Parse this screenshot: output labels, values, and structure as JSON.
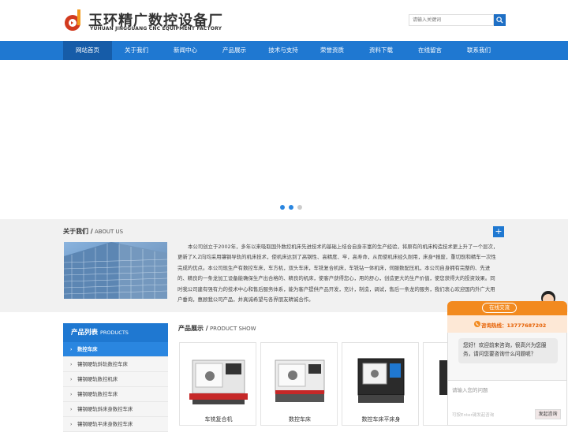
{
  "header": {
    "company_cn": "玉环精广数控设备厂",
    "company_en": "YUHUAN JINGGUANG CNC EQUIPMENT FACTORY",
    "search_placeholder": "请输入关键词"
  },
  "nav": {
    "items": [
      {
        "label": "网站首页",
        "active": true
      },
      {
        "label": "关于我们"
      },
      {
        "label": "新闻中心"
      },
      {
        "label": "产品展示"
      },
      {
        "label": "技术与支持"
      },
      {
        "label": "荣誉资质"
      },
      {
        "label": "资料下载"
      },
      {
        "label": "在线留言"
      },
      {
        "label": "联系我们"
      }
    ]
  },
  "banner": {
    "slides": 3,
    "active_slide": 2
  },
  "about": {
    "title_cn": "关于我们 /",
    "title_en": " ABOUT US",
    "plus": "+",
    "text": "本公司创立于2002年，多年以来吸取国外数控机床先进技术的基础上结合自身丰富的生产经验，将原有的机床构造技术更上升了一个层次，更新了X,Z向均采用镶钢导轨的机床技术，使机床达到了高钢性、高精度、牢，高寿命，从而使机床经久耐用，床身*报废，重切削和精车一次性完成的优点。本公司现生产有数控车床，车方机，双头车床，车铣复合机床，车铣钻一体机床，伺服数配压机，本公司自身拥有完整的、先进的、精良的一条龙加工设备能确保生产出合格的、精良的机床，使客户获得您心，用的舒心，创造更大的生产价值，使您获得大的投资效果。同时我公司建有强有力的技术中心和售后服务体系，能为客户提供产品开发，充计，制造，调试，售后一条龙的服务，我们衷心欢迎国内外广大用户垂询，惠顾我公司产品，并真诚希望与各界朋友精诚合作。"
  },
  "sidebar": {
    "title_cn": "产品列表",
    "title_en": "PRODUCTS",
    "items": [
      {
        "label": "数控车床",
        "active": true
      },
      {
        "label": "镶钢硬轨斜轨数控车床"
      },
      {
        "label": "镶钢硬轨数控机床"
      },
      {
        "label": "镶钢硬轨数控车床"
      },
      {
        "label": "镶钢硬轨斜床身数控车床"
      },
      {
        "label": "镶钢硬轨平床身数控车床"
      }
    ]
  },
  "products": {
    "title_cn": "产品展示 /",
    "title_en": " PRODUCT SHOW",
    "items": [
      {
        "name": "车铣复合机"
      },
      {
        "name": "数控车床"
      },
      {
        "name": "数控车床平床身"
      }
    ]
  },
  "chat": {
    "title": "在线交流",
    "hotline": "咨询热线：13777687202",
    "greeting": "您好！欢迎前来咨询，很高兴为您服务，请问您要咨询什么问题呢？",
    "input_placeholder": "请输入您的问题",
    "hint": "可按Enter键发起咨询",
    "send_label": "发起咨询"
  },
  "colors": {
    "primary": "#1f78d1",
    "nav_active": "#165ca8",
    "chat": "#f28a1f"
  }
}
